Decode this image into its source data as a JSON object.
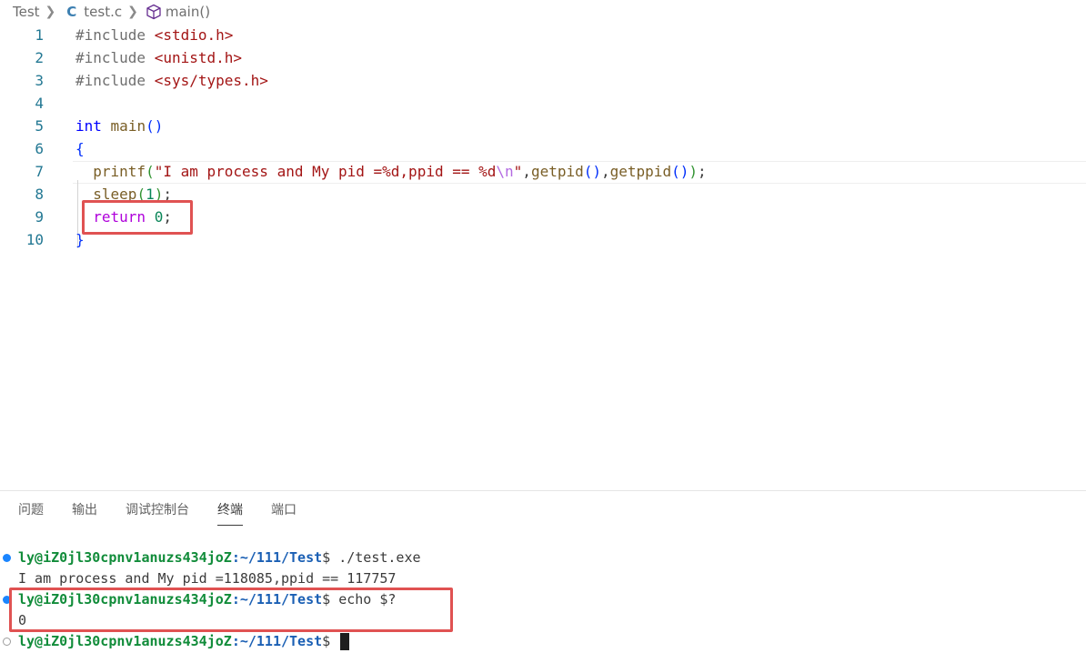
{
  "breadcrumb": {
    "folder": "Test",
    "file": "test.c",
    "file_icon": "C",
    "symbol": "main()"
  },
  "editor": {
    "lines": [
      {
        "n": "1",
        "tokens": [
          [
            "#include ",
            "tk-pre"
          ],
          [
            "<stdio.h>",
            "tk-str"
          ]
        ]
      },
      {
        "n": "2",
        "tokens": [
          [
            "#include ",
            "tk-pre"
          ],
          [
            "<unistd.h>",
            "tk-str"
          ]
        ]
      },
      {
        "n": "3",
        "tokens": [
          [
            "#include ",
            "tk-pre"
          ],
          [
            "<sys/types.h>",
            "tk-str"
          ]
        ]
      },
      {
        "n": "4",
        "tokens": []
      },
      {
        "n": "5",
        "tokens": [
          [
            "int",
            "tk-kw"
          ],
          [
            " ",
            "tk-punc"
          ],
          [
            "main",
            "tk-fn"
          ],
          [
            "()",
            "tk-brace"
          ]
        ]
      },
      {
        "n": "6",
        "tokens": [
          [
            "{",
            "tk-brace"
          ]
        ]
      },
      {
        "n": "7",
        "tokens": [
          [
            "  ",
            "tk-punc"
          ],
          [
            "printf",
            "tk-fn"
          ],
          [
            "(",
            "tk-paren2"
          ],
          [
            "\"I am process and My pid =%d,ppid == %d",
            "tk-str"
          ],
          [
            "\\n",
            "tk-esc2"
          ],
          [
            "\"",
            "tk-str"
          ],
          [
            ",",
            "tk-punc"
          ],
          [
            "getpid",
            "tk-fn"
          ],
          [
            "()",
            "tk-brace"
          ],
          [
            ",",
            "tk-punc"
          ],
          [
            "getppid",
            "tk-fn"
          ],
          [
            "()",
            "tk-brace"
          ],
          [
            ")",
            "tk-paren2"
          ],
          [
            ";",
            "tk-punc"
          ]
        ]
      },
      {
        "n": "8",
        "tokens": [
          [
            "  ",
            "tk-punc"
          ],
          [
            "sleep",
            "tk-fn"
          ],
          [
            "(",
            "tk-paren2"
          ],
          [
            "1",
            "tk-num"
          ],
          [
            ")",
            "tk-paren2"
          ],
          [
            ";",
            "tk-punc"
          ]
        ]
      },
      {
        "n": "9",
        "tokens": [
          [
            "  ",
            "tk-punc"
          ],
          [
            "return",
            "tk-ctl"
          ],
          [
            " ",
            "tk-punc"
          ],
          [
            "0",
            "tk-num"
          ],
          [
            ";",
            "tk-punc"
          ]
        ]
      },
      {
        "n": "10",
        "tokens": [
          [
            "}",
            "tk-brace"
          ]
        ]
      }
    ]
  },
  "panel": {
    "tabs": [
      "问题",
      "输出",
      "调试控制台",
      "终端",
      "端口"
    ],
    "active_tab": "终端"
  },
  "terminal": {
    "user_host": "ly@iZ0jl30cpnv1anuzs434joZ",
    "path": ":~/111/Test",
    "lines": [
      {
        "kind": "prompt",
        "deco": "ok",
        "cmd": " ./test.exe"
      },
      {
        "kind": "output",
        "text": "I am process and My pid =118085,ppid == 117757"
      },
      {
        "kind": "prompt",
        "deco": "ok",
        "cmd": " echo $?"
      },
      {
        "kind": "output",
        "text": "0"
      },
      {
        "kind": "prompt",
        "deco": "empty",
        "cmd": " "
      }
    ],
    "dollar": "$"
  },
  "colors": {
    "highlight": "#e05252",
    "line_number": "#237893"
  }
}
